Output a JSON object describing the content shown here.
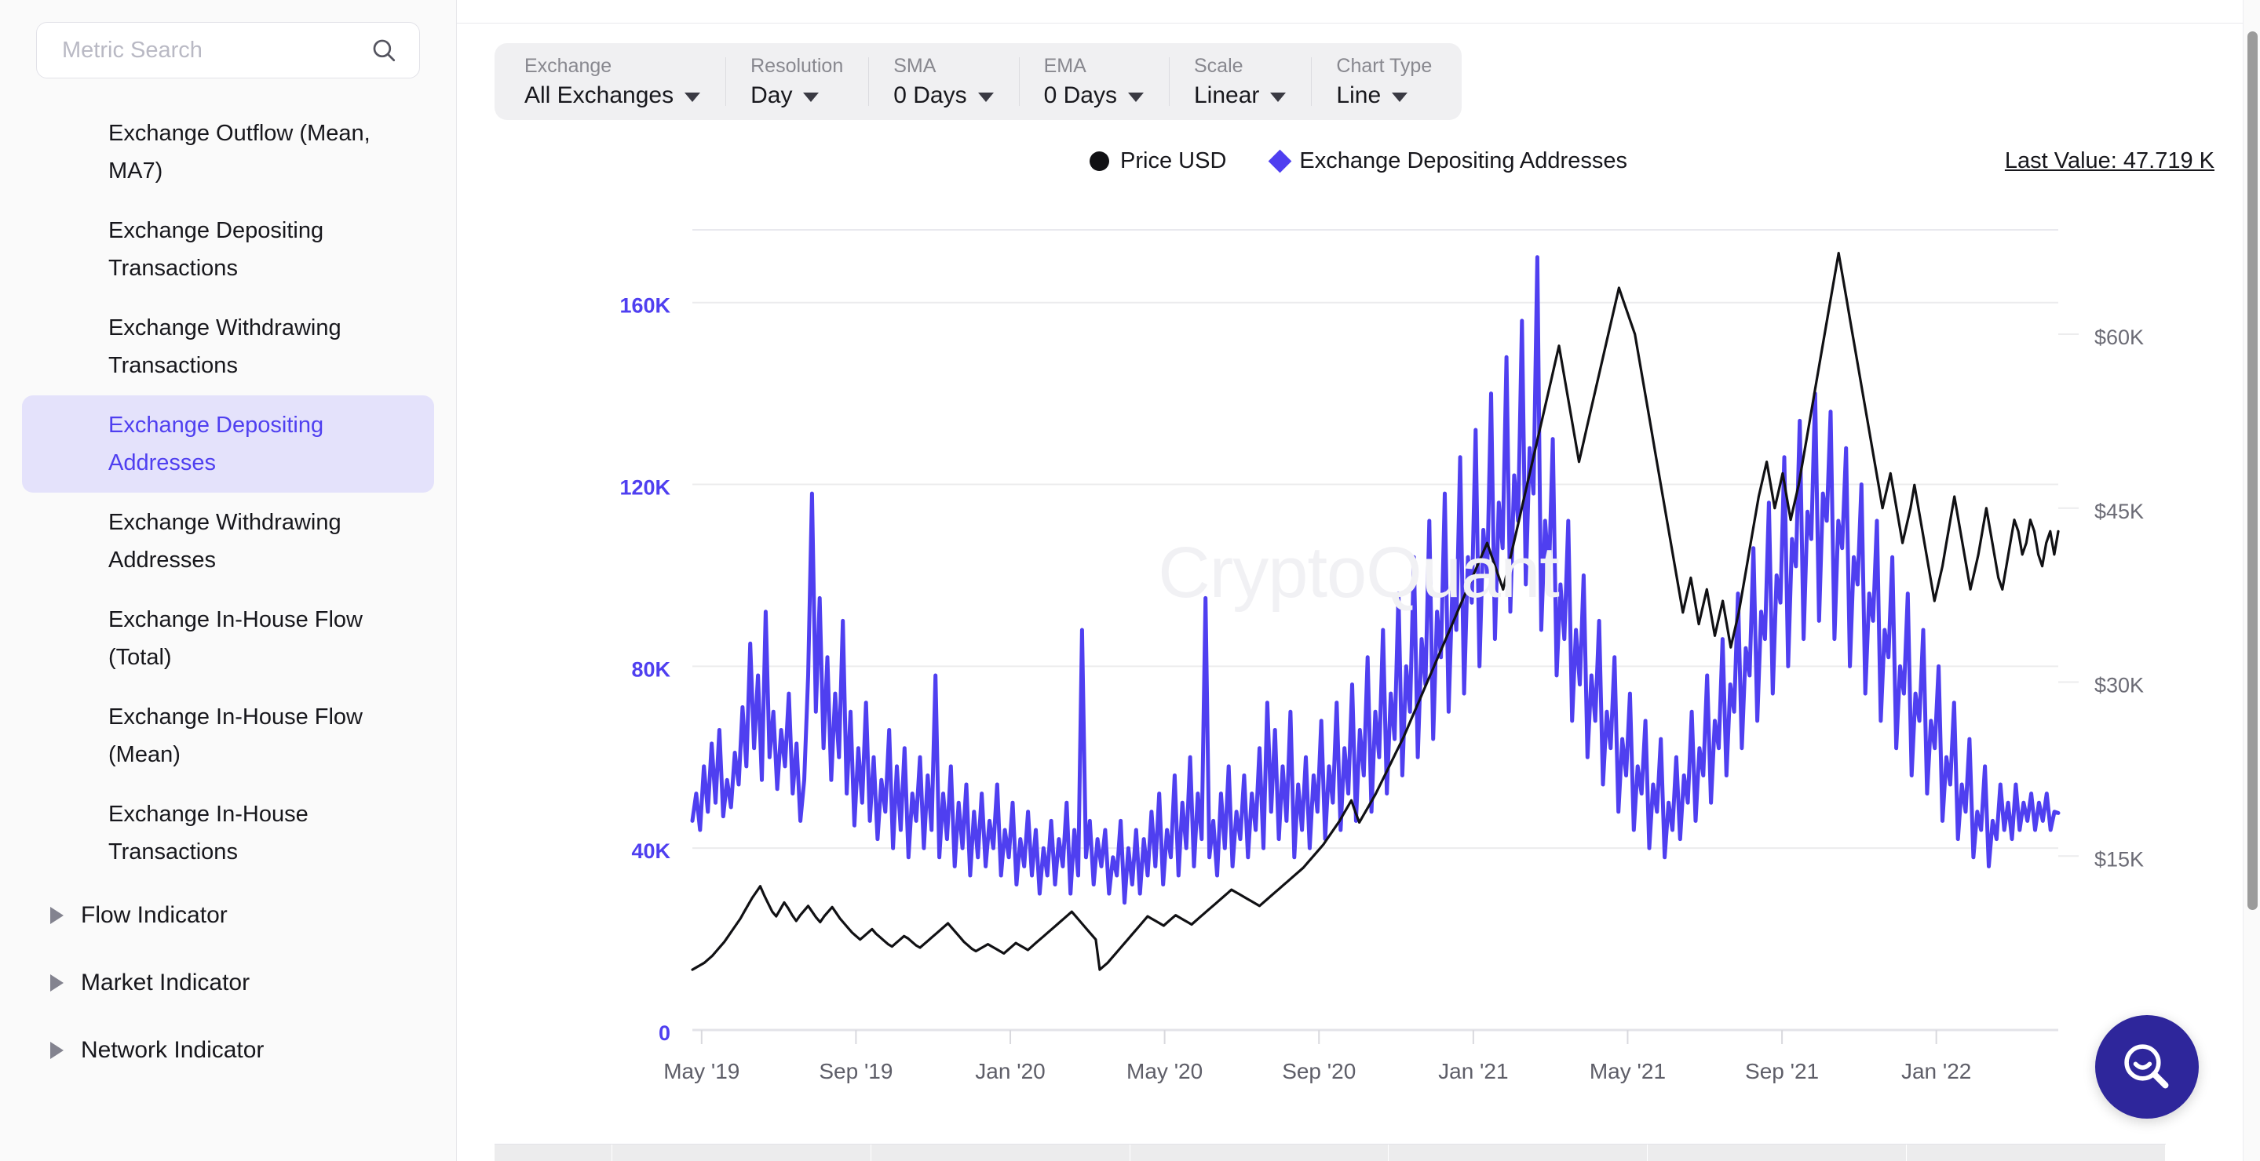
{
  "sidebar": {
    "search": {
      "placeholder": "Metric Search",
      "value": "",
      "icon": "search-icon"
    },
    "clipped_top_item": ",",
    "metrics": [
      {
        "label": "Exchange Outflow (Mean, MA7)",
        "active": false
      },
      {
        "label": "Exchange Depositing Transactions",
        "active": false
      },
      {
        "label": "Exchange Withdrawing Transactions",
        "active": false
      },
      {
        "label": "Exchange Depositing Addresses",
        "active": true
      },
      {
        "label": "Exchange Withdrawing Addresses",
        "active": false
      },
      {
        "label": "Exchange In-House Flow (Total)",
        "active": false
      },
      {
        "label": "Exchange In-House Flow (Mean)",
        "active": false
      },
      {
        "label": "Exchange In-House Transactions",
        "active": false
      }
    ],
    "groups": [
      {
        "label": "Flow Indicator",
        "icon": "caret-right-icon"
      },
      {
        "label": "Market Indicator",
        "icon": "caret-right-icon"
      },
      {
        "label": "Network Indicator",
        "icon": "caret-right-icon"
      }
    ]
  },
  "toolbar": {
    "fields": [
      {
        "label": "Exchange",
        "value": "All Exchanges"
      },
      {
        "label": "Resolution",
        "value": "Day"
      },
      {
        "label": "SMA",
        "value": "0 Days"
      },
      {
        "label": "EMA",
        "value": "0 Days"
      },
      {
        "label": "Scale",
        "value": "Linear"
      },
      {
        "label": "Chart Type",
        "value": "Line"
      }
    ]
  },
  "legend": {
    "items": [
      {
        "label": "Price USD",
        "marker": "circle",
        "color": "#111114"
      },
      {
        "label": "Exchange Depositing Addresses",
        "marker": "diamond",
        "color": "#4f3ff0"
      }
    ],
    "last_value": "Last Value: 47.719 K"
  },
  "watermark": "CryptoQuant",
  "help_button": {
    "icon": "search-smile-icon",
    "color": "#2e269b"
  },
  "chart_data": {
    "type": "line",
    "title": "",
    "xlabel": "",
    "grid": true,
    "legend_position": "top-center",
    "x_tick_labels": [
      "May '19",
      "Sep '19",
      "Jan '20",
      "May '20",
      "Sep '20",
      "Jan '21",
      "May '21",
      "Sep '21",
      "Jan '22"
    ],
    "axes": {
      "left": {
        "label": "Exchange Depositing Addresses",
        "ticks": [
          "0",
          "40K",
          "80K",
          "120K",
          "160K"
        ],
        "tick_values": [
          0,
          40000,
          80000,
          120000,
          160000
        ],
        "range": [
          0,
          176000
        ],
        "color": "#4f3ff0"
      },
      "right": {
        "label": "Price USD",
        "ticks": [
          "$15K",
          "$30K",
          "$45K",
          "$60K"
        ],
        "tick_values": [
          15000,
          30000,
          45000,
          60000
        ],
        "range": [
          0,
          69000
        ],
        "color": "#6b6b75"
      }
    },
    "series": [
      {
        "name": "Exchange Depositing Addresses",
        "color": "#4f3ff0",
        "axis": "left",
        "unit": "addresses",
        "last_value": 47719,
        "values": [
          46000,
          52000,
          44000,
          58000,
          48000,
          63000,
          50000,
          66000,
          47000,
          55000,
          49000,
          61000,
          54000,
          71000,
          58000,
          85000,
          62000,
          78000,
          55000,
          92000,
          60000,
          70000,
          53000,
          66000,
          58000,
          74000,
          52000,
          63000,
          46000,
          55000,
          78000,
          118000,
          70000,
          95000,
          62000,
          82000,
          55000,
          74000,
          60000,
          90000,
          52000,
          70000,
          45000,
          62000,
          50000,
          72000,
          46000,
          60000,
          42000,
          55000,
          48000,
          66000,
          40000,
          58000,
          44000,
          62000,
          38000,
          52000,
          46000,
          60000,
          40000,
          56000,
          44000,
          78000,
          38000,
          52000,
          42000,
          58000,
          36000,
          50000,
          40000,
          54000,
          34000,
          48000,
          38000,
          52000,
          36000,
          46000,
          40000,
          54000,
          34000,
          44000,
          38000,
          50000,
          32000,
          42000,
          36000,
          48000,
          34000,
          44000,
          30000,
          40000,
          34000,
          46000,
          32000,
          42000,
          36000,
          50000,
          30000,
          44000,
          34000,
          88000,
          38000,
          46000,
          32000,
          42000,
          36000,
          44000,
          30000,
          38000,
          34000,
          46000,
          28000,
          40000,
          32000,
          44000,
          30000,
          42000,
          34000,
          48000,
          36000,
          52000,
          32000,
          44000,
          38000,
          56000,
          34000,
          50000,
          40000,
          60000,
          36000,
          52000,
          42000,
          95000,
          38000,
          46000,
          34000,
          52000,
          40000,
          58000,
          36000,
          48000,
          42000,
          56000,
          38000,
          52000,
          44000,
          62000,
          40000,
          72000,
          48000,
          66000,
          42000,
          58000,
          46000,
          70000,
          38000,
          54000,
          44000,
          60000,
          40000,
          56000,
          48000,
          68000,
          42000,
          58000,
          50000,
          72000,
          44000,
          62000,
          52000,
          76000,
          46000,
          66000,
          56000,
          82000,
          48000,
          70000,
          60000,
          88000,
          52000,
          74000,
          64000,
          96000,
          56000,
          80000,
          70000,
          104000,
          60000,
          86000,
          76000,
          112000,
          64000,
          92000,
          82000,
          118000,
          70000,
          98000,
          88000,
          126000,
          74000,
          104000,
          94000,
          132000,
          80000,
          110000,
          100000,
          140000,
          86000,
          116000,
          106000,
          148000,
          92000,
          122000,
          112000,
          156000,
          98000,
          128000,
          118000,
          170000,
          88000,
          112000,
          100000,
          130000,
          78000,
          98000,
          86000,
          112000,
          68000,
          88000,
          76000,
          100000,
          60000,
          78000,
          68000,
          90000,
          54000,
          70000,
          62000,
          82000,
          48000,
          64000,
          56000,
          74000,
          44000,
          58000,
          52000,
          68000,
          40000,
          54000,
          48000,
          64000,
          38000,
          50000,
          44000,
          60000,
          42000,
          56000,
          50000,
          70000,
          46000,
          62000,
          56000,
          78000,
          50000,
          68000,
          62000,
          86000,
          56000,
          76000,
          70000,
          96000,
          62000,
          84000,
          78000,
          106000,
          68000,
          92000,
          86000,
          116000,
          74000,
          100000,
          94000,
          126000,
          80000,
          108000,
          102000,
          134000,
          86000,
          114000,
          108000,
          140000,
          90000,
          118000,
          112000,
          136000,
          86000,
          112000,
          106000,
          128000,
          80000,
          104000,
          98000,
          120000,
          74000,
          96000,
          90000,
          112000,
          68000,
          88000,
          82000,
          104000,
          62000,
          80000,
          74000,
          96000,
          56000,
          74000,
          68000,
          88000,
          52000,
          68000,
          62000,
          80000,
          46000,
          60000,
          54000,
          72000,
          42000,
          54000,
          48000,
          64000,
          38000,
          48000,
          44000,
          58000,
          36000,
          46000,
          42000,
          54000,
          44000,
          50000,
          42000,
          54000,
          44000,
          50000,
          46000,
          52000,
          44000,
          50000,
          46000,
          52000,
          44000,
          48000,
          47719
        ]
      },
      {
        "name": "Price USD",
        "color": "#111114",
        "axis": "right",
        "unit": "USD",
        "values": [
          5200,
          5400,
          5600,
          5800,
          6100,
          6400,
          6800,
          7200,
          7600,
          8100,
          8600,
          9100,
          9600,
          10200,
          10800,
          11400,
          11900,
          12400,
          11600,
          10900,
          10200,
          9800,
          10400,
          11000,
          10500,
          9900,
          9400,
          9900,
          10300,
          10700,
          10200,
          9700,
          9300,
          9800,
          10200,
          10600,
          10100,
          9600,
          9200,
          8800,
          8400,
          8100,
          7800,
          8100,
          8400,
          8700,
          8300,
          8000,
          7700,
          7400,
          7200,
          7500,
          7800,
          8100,
          7900,
          7600,
          7300,
          7100,
          7400,
          7700,
          8000,
          8300,
          8600,
          8900,
          9200,
          8800,
          8400,
          8000,
          7600,
          7300,
          7000,
          6800,
          7000,
          7200,
          7400,
          7200,
          7000,
          6800,
          6600,
          6900,
          7200,
          7500,
          7300,
          7100,
          6900,
          7200,
          7500,
          7800,
          8100,
          8400,
          8700,
          9000,
          9300,
          9600,
          9900,
          10200,
          9800,
          9400,
          9000,
          8600,
          8200,
          7800,
          5200,
          5500,
          5800,
          6200,
          6600,
          7000,
          7400,
          7800,
          8200,
          8600,
          9000,
          9400,
          9800,
          9600,
          9400,
          9200,
          9000,
          9300,
          9600,
          9900,
          9700,
          9500,
          9300,
          9100,
          9400,
          9700,
          10000,
          10300,
          10600,
          10900,
          11200,
          11500,
          11800,
          12100,
          11900,
          11700,
          11500,
          11300,
          11100,
          10900,
          10700,
          11000,
          11300,
          11600,
          11900,
          12200,
          12500,
          12800,
          13100,
          13400,
          13700,
          14000,
          14400,
          14800,
          15200,
          15600,
          16000,
          16500,
          17000,
          17500,
          18000,
          18600,
          19200,
          19800,
          18800,
          17900,
          18500,
          19100,
          19700,
          20300,
          21000,
          21700,
          22400,
          23100,
          23800,
          24500,
          25200,
          26000,
          26800,
          27600,
          28400,
          29200,
          30000,
          30800,
          31600,
          32400,
          33200,
          34000,
          34800,
          35600,
          36400,
          37200,
          38000,
          38800,
          39600,
          40400,
          41200,
          42000,
          41000,
          40000,
          39000,
          38000,
          39500,
          41000,
          42500,
          44000,
          45500,
          47000,
          48500,
          50000,
          51500,
          53000,
          54500,
          56000,
          57500,
          59000,
          57000,
          55000,
          53000,
          51000,
          49000,
          50500,
          52000,
          53500,
          55000,
          56500,
          58000,
          59500,
          61000,
          62500,
          64000,
          63000,
          62000,
          61000,
          60000,
          58000,
          56000,
          54000,
          52000,
          50000,
          48000,
          46000,
          44000,
          42000,
          40000,
          38000,
          36000,
          37500,
          39000,
          37000,
          35000,
          36500,
          38000,
          36000,
          34000,
          35500,
          37000,
          35000,
          33000,
          34500,
          36000,
          38000,
          40000,
          42000,
          44000,
          46000,
          47500,
          49000,
          47000,
          45000,
          46500,
          48000,
          46000,
          44000,
          45500,
          47000,
          49000,
          51000,
          53000,
          55000,
          57000,
          59000,
          61000,
          63000,
          65000,
          67000,
          65000,
          63000,
          61000,
          59000,
          57000,
          55000,
          53000,
          51000,
          49000,
          47000,
          45000,
          46500,
          48000,
          46000,
          44000,
          42000,
          43500,
          45000,
          47000,
          45000,
          43000,
          41000,
          39000,
          37000,
          38500,
          40000,
          42000,
          44000,
          46000,
          44000,
          42000,
          40000,
          38000,
          39500,
          41000,
          43000,
          45000,
          43000,
          41000,
          39000,
          38000,
          40000,
          42000,
          44000,
          43000,
          41000,
          42000,
          44000,
          43000,
          41000,
          40000,
          42000,
          43000,
          41000,
          43000
        ]
      }
    ]
  }
}
